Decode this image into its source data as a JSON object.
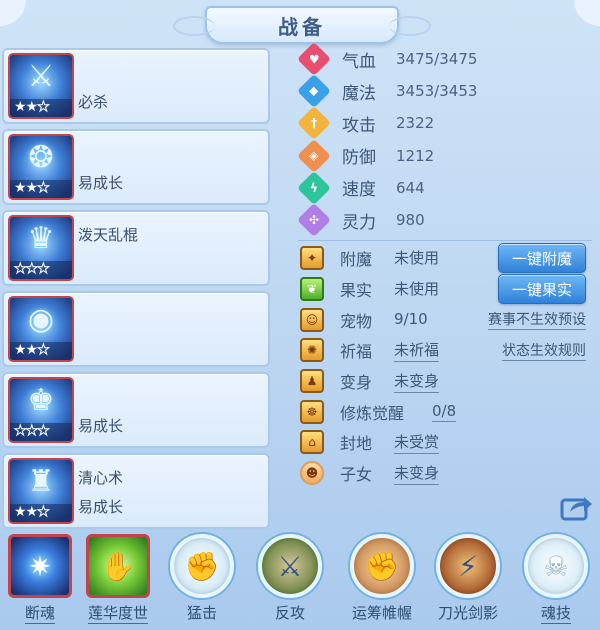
{
  "title": "战备",
  "skills": [
    {
      "name_top": "",
      "name_bottom": "必杀",
      "stars": 2,
      "icon": "sword-icon"
    },
    {
      "name_top": "",
      "name_bottom": "易成长",
      "stars": 2,
      "icon": "beast-icon"
    },
    {
      "name_top": "泼天乱棍",
      "name_bottom": "",
      "stars": 0,
      "icon": "armor-icon"
    },
    {
      "name_top": "",
      "name_bottom": "",
      "stars": 2,
      "icon": "orb-icon"
    },
    {
      "name_top": "",
      "name_bottom": "易成长",
      "stars": 0,
      "icon": "crown-icon"
    },
    {
      "name_top": "清心术",
      "name_bottom": "易成长",
      "stars": 2,
      "icon": "spirit-icon"
    }
  ],
  "stats": [
    {
      "label": "气血",
      "value": "3475/3475",
      "color": "#e84e6f",
      "icon": "heart-icon"
    },
    {
      "label": "魔法",
      "value": "3453/3453",
      "color": "#3aa0e8",
      "icon": "mana-icon"
    },
    {
      "label": "攻击",
      "value": "2322",
      "color": "#f3b43d",
      "icon": "attack-icon"
    },
    {
      "label": "防御",
      "value": "1212",
      "color": "#f09050",
      "icon": "defense-icon"
    },
    {
      "label": "速度",
      "value": "644",
      "color": "#2fc59a",
      "icon": "speed-icon"
    },
    {
      "label": "灵力",
      "value": "980",
      "color": "#b07ee6",
      "icon": "spirit-power-icon"
    }
  ],
  "status": [
    {
      "label": "附魔",
      "value": "未使用",
      "underline": false
    },
    {
      "label": "果实",
      "value": "未使用",
      "underline": false
    },
    {
      "label": "宠物",
      "value": "9/10",
      "underline": false
    },
    {
      "label": "祈福",
      "value": "未祈福",
      "underline": true
    },
    {
      "label": "变身",
      "value": "未变身",
      "underline": true
    },
    {
      "label": "修炼觉醒",
      "value": "0/8",
      "underline": true
    },
    {
      "label": "封地",
      "value": "未受赏",
      "underline": true
    },
    {
      "label": "子女",
      "value": "未变身",
      "underline": true
    }
  ],
  "buttons": {
    "enchant": "一键附魔",
    "fruit": "一键果实"
  },
  "links": {
    "preset": "赛事不生效预设",
    "rules": "状态生效规则"
  },
  "bottom_skills": [
    {
      "label": "断魂",
      "style": "square",
      "underline": true,
      "icon": "soul-icon"
    },
    {
      "label": "莲华度世",
      "style": "square",
      "underline": true,
      "icon": "lotus-hand-icon"
    },
    {
      "label": "猛击",
      "style": "circle",
      "underline": false,
      "icon": "fist-icon"
    },
    {
      "label": "反攻",
      "style": "circle",
      "underline": false,
      "icon": "counter-icon"
    },
    {
      "label": "运筹帷幄",
      "style": "circle",
      "underline": false,
      "icon": "strategy-icon"
    },
    {
      "label": "刀光剑影",
      "style": "circle",
      "underline": false,
      "icon": "blade-icon"
    },
    {
      "label": "魂技",
      "style": "circle",
      "underline": true,
      "icon": "skull-icon"
    }
  ]
}
